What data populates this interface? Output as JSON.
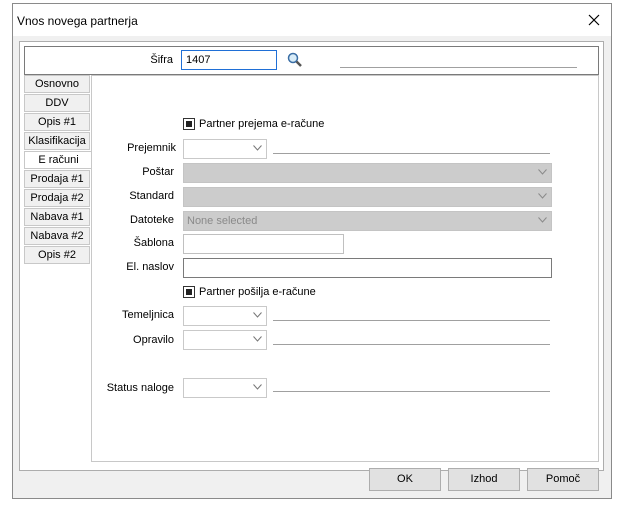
{
  "window": {
    "title": "Vnos novega partnerja"
  },
  "header": {
    "code_label": "Šifra",
    "code_value": "1407",
    "search_icon": "magnifier-icon"
  },
  "tabs": [
    "Osnovno",
    "DDV",
    "Opis #1",
    "Klasifikacija",
    "E računi",
    "Prodaja #1",
    "Prodaja #2",
    "Nabava #1",
    "Nabava #2",
    "Opis #2"
  ],
  "active_tab": "E računi",
  "form": {
    "receives_label": "Partner prejema e-račune",
    "recipient_label": "Prejemnik",
    "postman_label": "Poštar",
    "standard_label": "Standard",
    "files_label": "Datoteke",
    "files_placeholder": "None selected",
    "template_label": "Šablona",
    "email_label": "El. naslov",
    "sends_label": "Partner pošilja e-račune",
    "journal_label": "Temeljnica",
    "task_label": "Opravilo",
    "status_label": "Status naloge"
  },
  "buttons": {
    "ok": "OK",
    "exit": "Izhod",
    "help": "Pomoč"
  }
}
